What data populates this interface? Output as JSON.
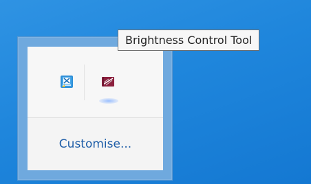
{
  "tooltip": {
    "text": "Brightness Control Tool"
  },
  "tray": {
    "customise_label": "Customise...",
    "icons": [
      {
        "name": "excel-sync-icon"
      },
      {
        "name": "brightness-control-icon"
      }
    ]
  },
  "colors": {
    "desktop_blue": "#1f86dc",
    "panel_blue": "#6fa9de",
    "link_blue": "#1f5ea8",
    "tooltip_border": "#6f6f6f",
    "icon_maroon": "#8b1f3d",
    "icon_blue": "#2f8fd8"
  }
}
